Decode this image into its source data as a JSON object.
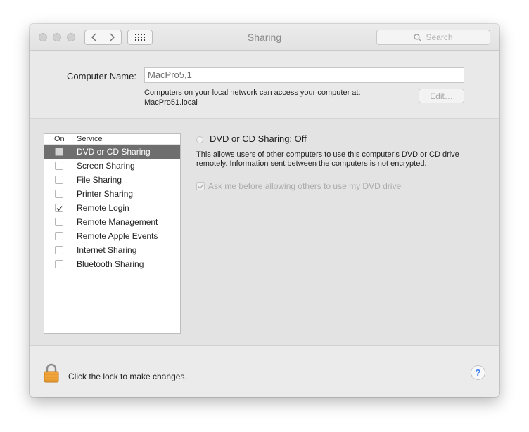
{
  "window": {
    "title": "Sharing",
    "search_placeholder": "Search"
  },
  "computer_name": {
    "label": "Computer Name:",
    "value": "MacPro5,1",
    "description_line1": "Computers on your local network can access your computer at:",
    "description_line2": "MacPro51.local",
    "edit_label": "Edit…"
  },
  "services": {
    "header_on": "On",
    "header_service": "Service",
    "items": [
      {
        "label": "DVD or CD Sharing",
        "checked": false,
        "selected": true
      },
      {
        "label": "Screen Sharing",
        "checked": false,
        "selected": false
      },
      {
        "label": "File Sharing",
        "checked": false,
        "selected": false
      },
      {
        "label": "Printer Sharing",
        "checked": false,
        "selected": false
      },
      {
        "label": "Remote Login",
        "checked": true,
        "selected": false
      },
      {
        "label": "Remote Management",
        "checked": false,
        "selected": false
      },
      {
        "label": "Remote Apple Events",
        "checked": false,
        "selected": false
      },
      {
        "label": "Internet Sharing",
        "checked": false,
        "selected": false
      },
      {
        "label": "Bluetooth Sharing",
        "checked": false,
        "selected": false
      }
    ]
  },
  "detail": {
    "status": "DVD or CD Sharing: Off",
    "description": "This allows users of other computers to use this computer's DVD or CD drive remotely. Information sent between the computers is not encrypted.",
    "ask_label": "Ask me before allowing others to use my DVD drive",
    "ask_checked": true
  },
  "footer": {
    "lock_text": "Click the lock to make changes.",
    "help_label": "?"
  },
  "icons": {
    "back": "chevron-left-icon",
    "forward": "chevron-right-icon",
    "show_all": "grid-icon",
    "search": "magnifier-icon",
    "lock": "padlock-icon",
    "help": "question-mark-icon"
  }
}
